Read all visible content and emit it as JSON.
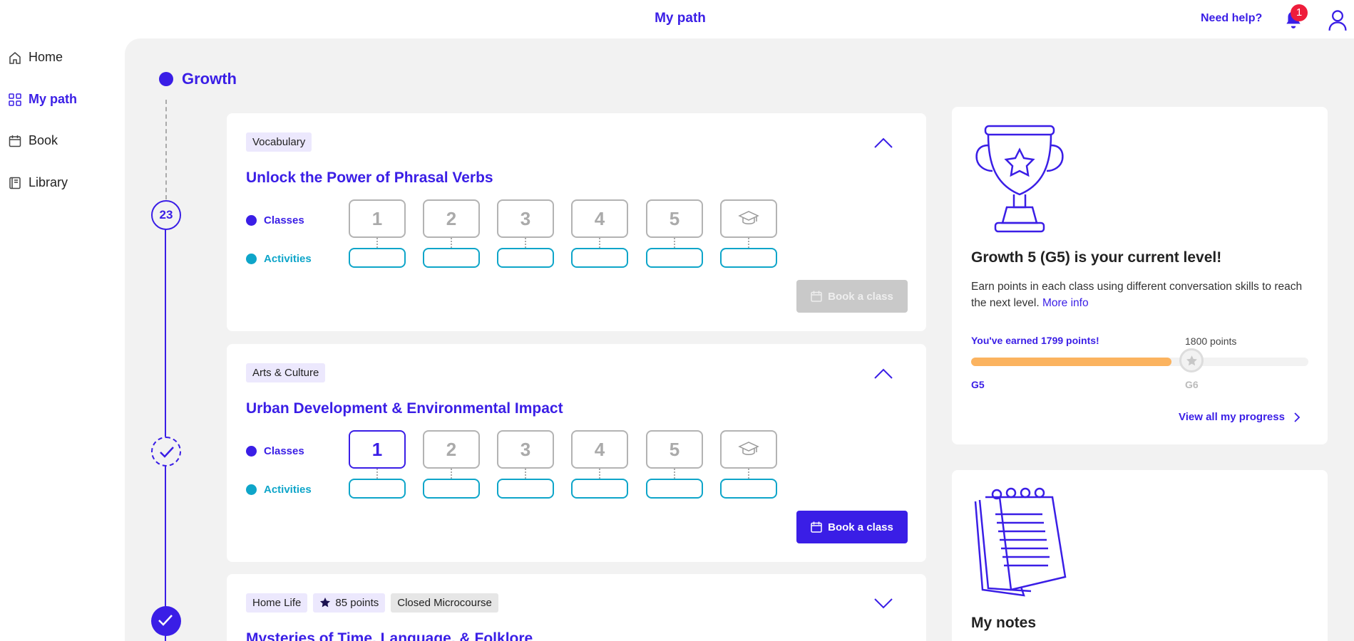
{
  "header": {
    "title": "My path",
    "help": "Need help?",
    "notification_count": "1"
  },
  "sidebar": {
    "items": [
      {
        "label": "Home",
        "icon": "home-icon"
      },
      {
        "label": "My path",
        "icon": "grid-icon",
        "active": true
      },
      {
        "label": "Book",
        "icon": "calendar-icon"
      },
      {
        "label": "Library",
        "icon": "book-icon"
      }
    ]
  },
  "timeline": {
    "level_name": "Growth",
    "node_number": "23"
  },
  "course_cards": [
    {
      "tags": [
        "Vocabulary"
      ],
      "title": "Unlock the Power of Phrasal Verbs",
      "classes_label": "Classes",
      "activities_label": "Activities",
      "class_numbers": [
        "1",
        "2",
        "3",
        "4",
        "5"
      ],
      "book_label": "Book a class",
      "book_enabled": false
    },
    {
      "tags": [
        "Arts & Culture"
      ],
      "title": "Urban Development & Environmental Impact",
      "classes_label": "Classes",
      "activities_label": "Activities",
      "class_numbers": [
        "1",
        "2",
        "3",
        "4",
        "5"
      ],
      "current_class": "1",
      "book_label": "Book a class",
      "book_enabled": true
    },
    {
      "tags": [
        "Home Life",
        "85 points",
        "Closed Microcourse"
      ],
      "title": "Mysteries of Time, Language, & Folklore"
    }
  ],
  "level_card": {
    "title": "Growth 5 (G5) is your current level!",
    "description": "Earn points in each class using different conversation skills to reach the next level.",
    "more_info": "More info",
    "earned": "You've earned 1799 points!",
    "target": "1800 points",
    "points_earned": 1799,
    "points_target": 1800,
    "current_level": "G5",
    "next_level": "G6",
    "progress_link": "View all my progress"
  },
  "notes_card": {
    "title": "My notes"
  },
  "colors": {
    "accent": "#3a1ee6",
    "activities": "#0ea5c9",
    "progress": "#fbb35f",
    "badge": "#ee1d3b"
  }
}
